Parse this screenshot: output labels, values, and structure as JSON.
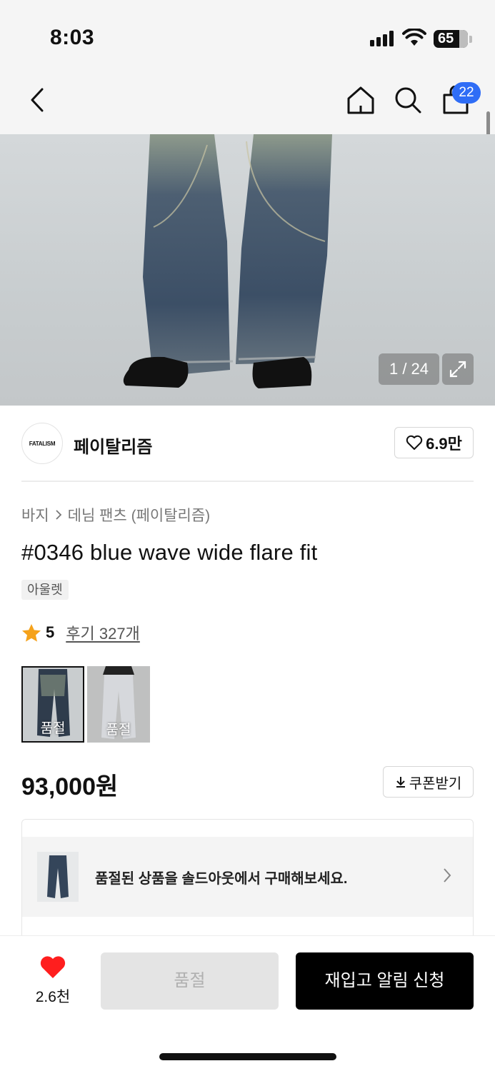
{
  "status_bar": {
    "time": "8:03",
    "battery": "65"
  },
  "nav": {
    "back_icon": "chevron-left-icon",
    "home_icon": "home-icon",
    "search_icon": "search-icon",
    "cart_icon": "shopping-bag-icon",
    "cart_count": "22",
    "badge_color": "#2f6df6"
  },
  "gallery": {
    "counter": "1 / 24",
    "expand_icon": "expand-icon"
  },
  "brand": {
    "logo_text": "FATALISM",
    "name": "페이탈리즘",
    "likes": "6.9만"
  },
  "product": {
    "breadcrumb": [
      "바지",
      "데님 팬츠 (페이탈리즘)"
    ],
    "title": "#0346 blue wave wide flare fit",
    "tag": "아울렛",
    "rating": "5",
    "reviews": "후기 327개",
    "star_color": "#f5a21b",
    "price": "93,000원",
    "coupon_label": "쿠폰받기"
  },
  "options": [
    {
      "label": "품절",
      "selected": true
    },
    {
      "label": "품절",
      "selected": false
    }
  ],
  "banner": {
    "text": "품절된 상품을 솔드아웃에서 구매해보세요."
  },
  "bottom": {
    "wish_count": "2.6천",
    "wish_color": "#ff1e1e",
    "soldout_label": "품절",
    "restock_label": "재입고 알림 신청"
  }
}
